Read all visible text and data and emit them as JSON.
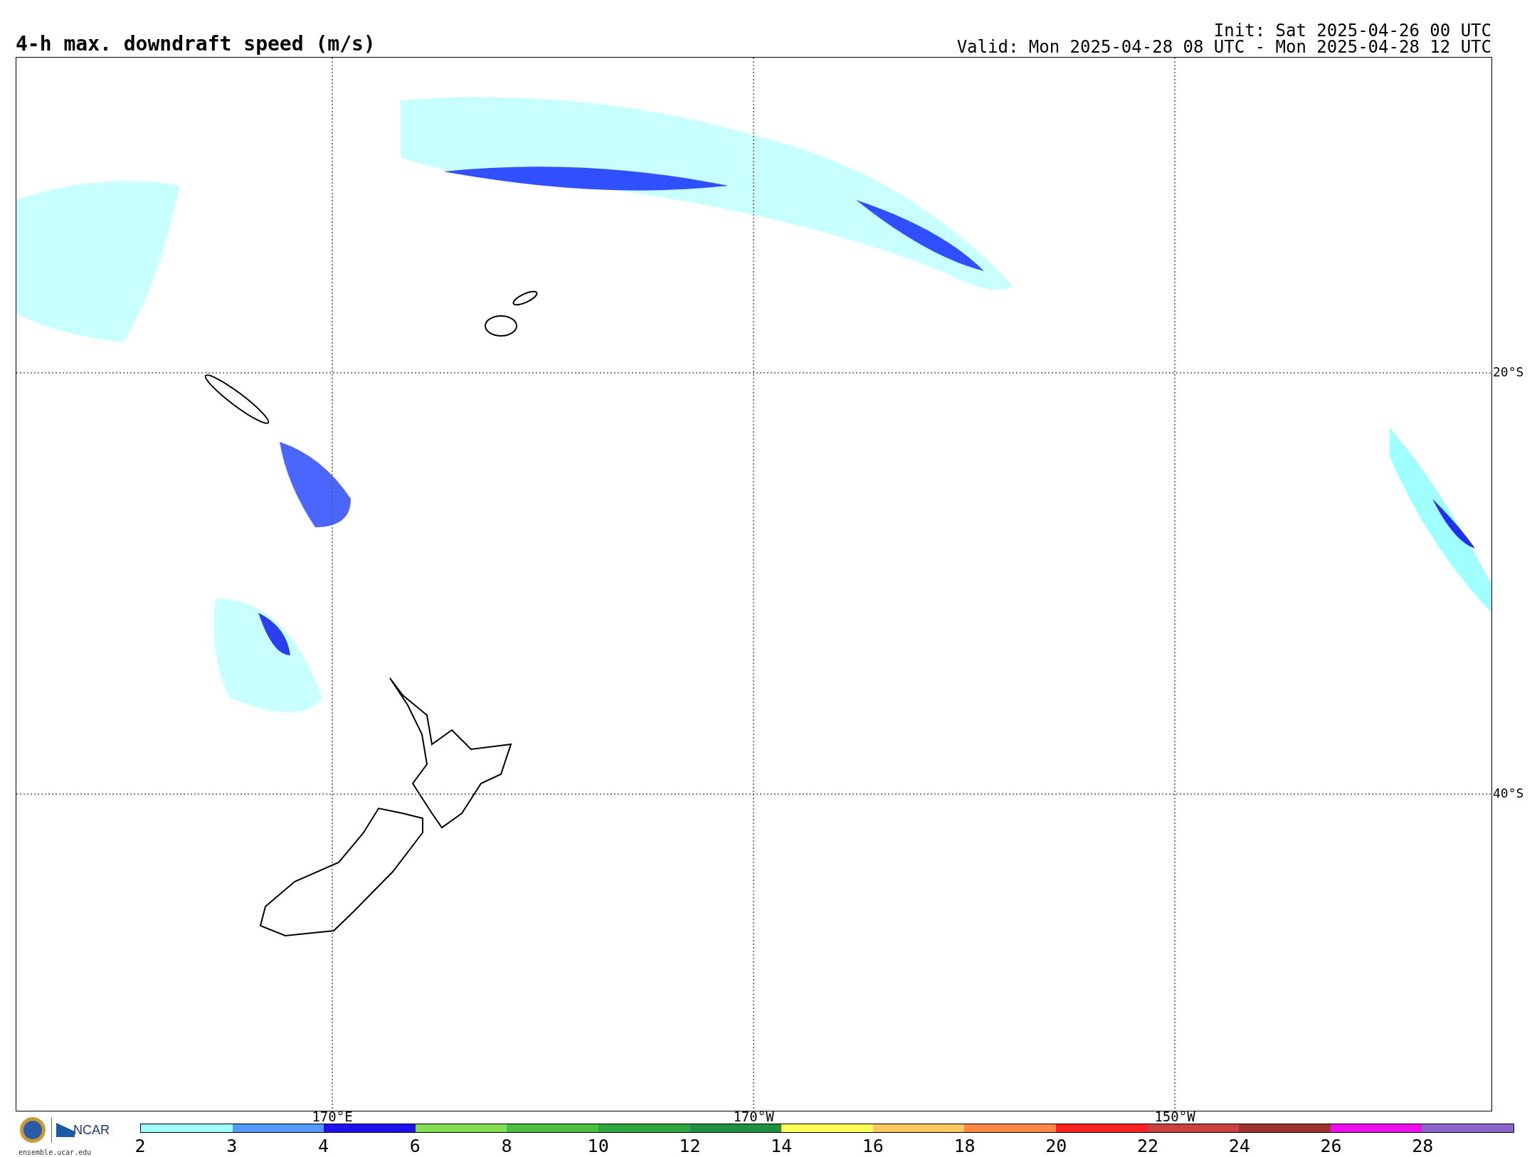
{
  "title": "4-h max. downdraft speed (m/s)",
  "init": "Init: Sat 2025-04-26 00 UTC",
  "valid": "Valid: Mon 2025-04-28 08 UTC - Mon 2025-04-28 12 UTC",
  "map": {
    "lon_labels": [
      "170°E",
      "170°W",
      "150°W"
    ],
    "lat_labels": [
      "20°S",
      "40°S"
    ]
  },
  "logo": {
    "org": "NCAR",
    "url": "ensemble.ucar.edu"
  },
  "colorbar": {
    "segments": [
      {
        "label": "2",
        "color": "#a0ffff"
      },
      {
        "label": "3",
        "color": "#5599ff"
      },
      {
        "label": "4",
        "color": "#1e10f0"
      },
      {
        "label": "6",
        "color": "#80e050"
      },
      {
        "label": "8",
        "color": "#4cc040"
      },
      {
        "label": "10",
        "color": "#2ea83c"
      },
      {
        "label": "12",
        "color": "#1e9040"
      },
      {
        "label": "14",
        "color": "#ffff55"
      },
      {
        "label": "16",
        "color": "#ffc860"
      },
      {
        "label": "18",
        "color": "#ff8844"
      },
      {
        "label": "20",
        "color": "#ff2020"
      },
      {
        "label": "22",
        "color": "#cc4040"
      },
      {
        "label": "24",
        "color": "#a03030"
      },
      {
        "label": "26",
        "color": "#ee11ee"
      },
      {
        "label": "28",
        "color": "#8866cc"
      }
    ]
  }
}
